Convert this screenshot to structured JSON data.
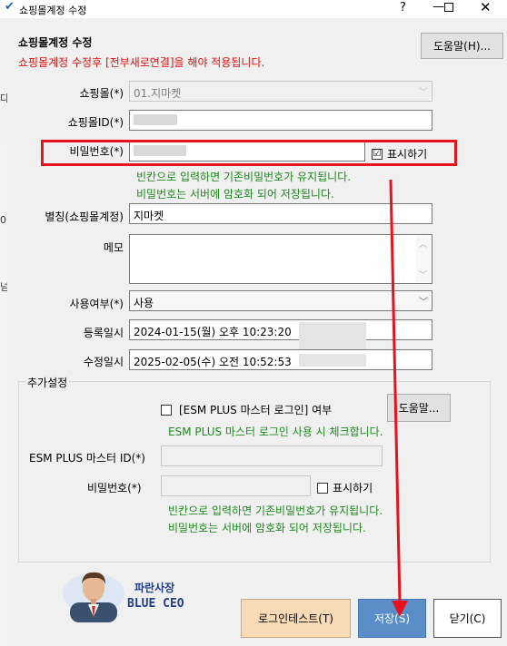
{
  "window": {
    "title": "쇼핑몰계정 수정",
    "help_glyph": "?",
    "min_glyph": "—",
    "close_glyph": "✕"
  },
  "left_strip": {
    "a": "다",
    "b": "0",
    "c": "넘"
  },
  "form": {
    "heading": "쇼핑몰계정 수정",
    "help_button": "도움말(H)...",
    "notice": "쇼핑몰계정 수정후 [전부새로연결]을 해야 적용됩니다.",
    "mall_label": "쇼핑몰(*)",
    "mall_value": "01.지마켓",
    "mall_id_label": "쇼핑몰ID(*)",
    "password_label": "비밀번호(*)",
    "show_password_label": "표시하기",
    "show_password_checked": "☑",
    "password_hint_1": "빈칸으로 입력하면 기존비밀번호가 유지됩니다.",
    "password_hint_2": "비밀번호는 서버에 암호화 되어 저장됩니다.",
    "alias_label": "별칭(쇼핑몰계정)",
    "alias_value": "지마켓",
    "memo_label": "메모",
    "use_label": "사용여부(*)",
    "use_value": "사용",
    "reg_label": "등록일시",
    "reg_value": "2024-01-15(월) 오후 10:23:20",
    "mod_label": "수정일시",
    "mod_value": "2025-02-05(수) 오전 10:52:53"
  },
  "extra": {
    "group_title": "추가설정",
    "esm_master_login_label": "[ESM PLUS 마스터 로그인] 여부",
    "esm_help_button": "도움말...",
    "esm_hint": "ESM PLUS 마스터 로그인 사용 시 체크합니다.",
    "esm_master_id_label": "ESM PLUS 마스터 ID(*)",
    "esm_password_label": "비밀번호(*)",
    "esm_show_password_label": "표시하기",
    "esm_password_hint_1": "빈칸으로 입력하면 기존비밀번호가 유지됩니다.",
    "esm_password_hint_2": "비밀번호는 서버에 암호화 되어 저장됩니다."
  },
  "footer": {
    "logo_line1": "파란사장",
    "logo_line2": "BLUE CEO",
    "login_test_button": "로그인테스트(T)",
    "save_button": "저장(S)",
    "close_button": "닫기(C)"
  },
  "colors": {
    "notice_red": "#e01010",
    "hint_green": "#1c8a1c",
    "highlight_red": "#e8121c",
    "save_blue": "#5b8ec9",
    "login_test_peach": "#f9dab6"
  }
}
